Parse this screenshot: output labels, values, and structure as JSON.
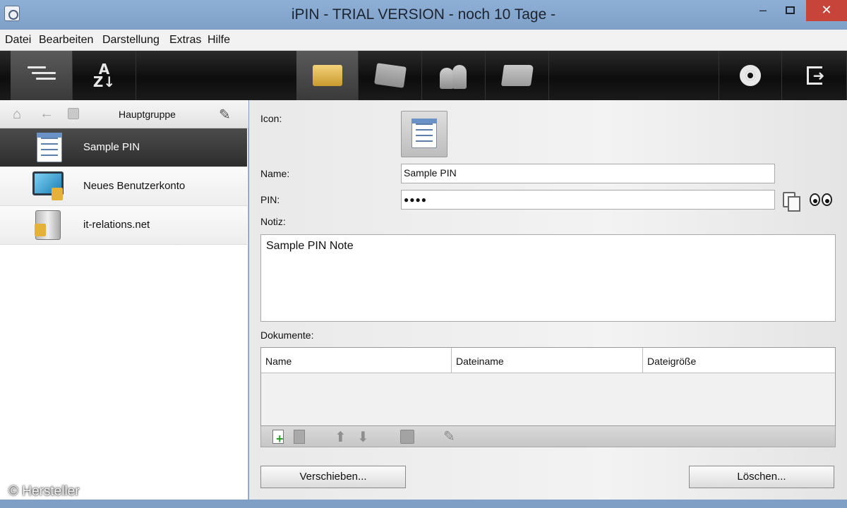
{
  "window": {
    "title": "iPIN - TRIAL VERSION - noch 10 Tage -",
    "minimize": "–",
    "close": "✕"
  },
  "menu": [
    "Datei",
    "Bearbeiten",
    "Darstellung",
    "Extras",
    "Hilfe"
  ],
  "toolbar": {
    "left_tools": [
      "tree-view-icon",
      "sort-az-icon"
    ],
    "center_tools": [
      "pin-folder-icon",
      "card-icon",
      "users-keys-icon",
      "folder-icon"
    ],
    "right_tools": [
      "gear-icon",
      "exit-icon"
    ],
    "sort_label": "A\nZ↓"
  },
  "left_panel": {
    "group_title": "Hauptgruppe",
    "entries": [
      {
        "label": "Sample PIN",
        "icon": "document-icon",
        "selected": true
      },
      {
        "label": "Neues Benutzerkonto",
        "icon": "monitor-lock-icon",
        "selected": false
      },
      {
        "label": "it-relations.net",
        "icon": "server-lock-icon",
        "selected": false
      }
    ]
  },
  "form": {
    "icon_label": "Icon:",
    "name_label": "Name:",
    "name_value": "Sample PIN",
    "pin_label": "PIN:",
    "pin_value": "●●●●",
    "note_label": "Notiz:",
    "note_value": "Sample PIN Note",
    "documents_label": "Dokumente:",
    "columns": [
      "Name",
      "Dateiname",
      "Dateigröße"
    ],
    "move_button": "Verschieben...",
    "delete_button": "Löschen..."
  },
  "credit": "© Hersteller"
}
